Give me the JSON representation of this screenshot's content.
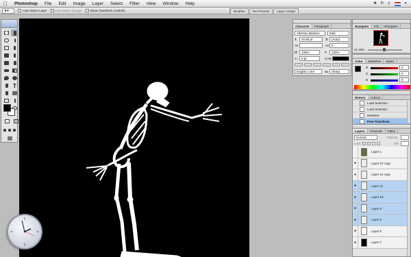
{
  "menubar": {
    "apple": "",
    "items": [
      "Photoshop",
      "File",
      "Edit",
      "Image",
      "Layer",
      "Select",
      "Filter",
      "View",
      "Window",
      "Help"
    ],
    "clock": "4:14 PM"
  },
  "options": {
    "auto_select_layer": "Auto Select Layer",
    "auto_select_groups": "Auto Select Groups",
    "show_transform_controls": "Show Transform Controls",
    "wells": [
      "Brushes",
      "Tool Presets",
      "Layer Comps"
    ]
  },
  "character": {
    "tabs": [
      "Character",
      "Paragraph"
    ],
    "font_family": "Albertus Medium",
    "font_style": "Italic",
    "font_size": "20.69 pt",
    "leading": "(Auto)",
    "tracking": "0",
    "vscale": "100%",
    "hscale": "100%",
    "baseline": "0 pt",
    "color_label": "Color:",
    "language": "English: USA",
    "aa": "Sharp"
  },
  "navigator": {
    "tabs": [
      "Navigator",
      "Info",
      "Histogram"
    ],
    "zoom": "31.33%"
  },
  "color": {
    "tabs": [
      "Color",
      "Swatches",
      "Styles"
    ],
    "values": [
      "0",
      "0",
      "0"
    ]
  },
  "history": {
    "tabs": [
      "History",
      "Actions"
    ],
    "items": [
      {
        "label": "Load Selection",
        "selected": false
      },
      {
        "label": "Load Selection",
        "selected": false
      },
      {
        "label": "Deselect",
        "selected": false
      },
      {
        "label": "Free Transform",
        "selected": true
      }
    ]
  },
  "layers": {
    "tabs": [
      "Layers",
      "Channels",
      "Paths"
    ],
    "blend": "Normal",
    "opacity_label": "Opacity:",
    "lock_label": "Lock:",
    "fill_label": "Fill:",
    "items": [
      {
        "label": "Layer 1",
        "visible": false,
        "selected": false,
        "thumb": "img"
      },
      {
        "label": "Layer 10 copy",
        "visible": true,
        "selected": false,
        "thumb": "checker"
      },
      {
        "label": "Layer 11 copy",
        "visible": true,
        "selected": false,
        "thumb": "checker"
      },
      {
        "label": "Layer 11",
        "visible": true,
        "selected": true,
        "thumb": "checker"
      },
      {
        "label": "Layer 10",
        "visible": true,
        "selected": true,
        "thumb": "checker"
      },
      {
        "label": "Layer 9",
        "visible": true,
        "selected": true,
        "thumb": "checker"
      },
      {
        "label": "Layer 8",
        "visible": true,
        "selected": true,
        "thumb": "checker"
      },
      {
        "label": "Layer 5",
        "visible": true,
        "selected": false,
        "thumb": "blank"
      },
      {
        "label": "Layer 7",
        "visible": true,
        "selected": false,
        "thumb": "black"
      }
    ]
  },
  "colors": {
    "selection": "#b6d4f2",
    "history_selection": "#9cc2ea",
    "canvas": "#000000"
  }
}
